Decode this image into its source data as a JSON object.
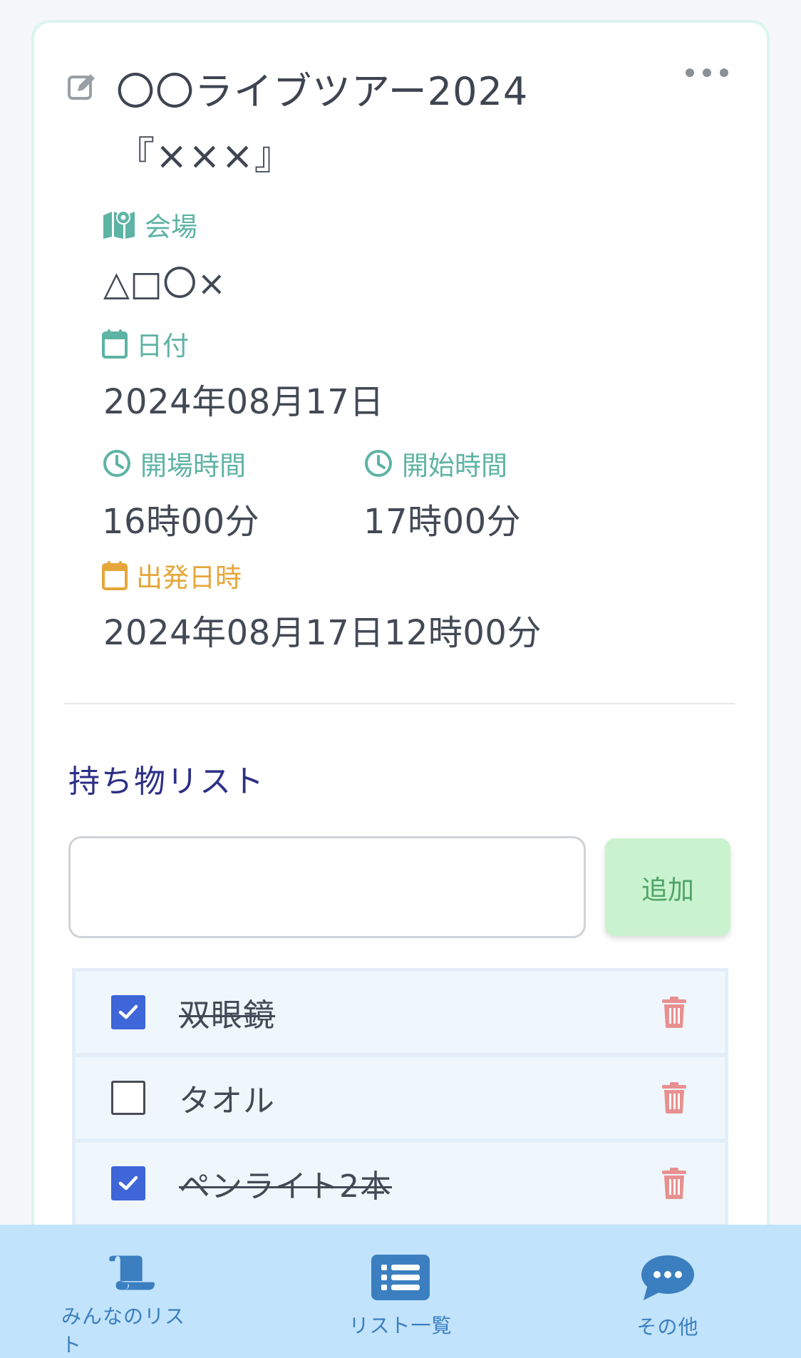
{
  "event": {
    "title": "〇〇ライブツアー2024『×××』",
    "venue_label": "会場",
    "venue_value": "△□〇×",
    "date_label": "日付",
    "date_value": "2024年08月17日",
    "open_label": "開場時間",
    "open_value": "16時00分",
    "start_label": "開始時間",
    "start_value": "17時00分",
    "departure_label": "出発日時",
    "departure_value": "2024年08月17日12時00分"
  },
  "checklist": {
    "title": "持ち物リスト",
    "input_value": "",
    "input_placeholder": "",
    "add_label": "追加",
    "items": [
      {
        "label": "双眼鏡",
        "checked": true
      },
      {
        "label": "タオル",
        "checked": false
      },
      {
        "label": "ペンライト2本",
        "checked": true
      }
    ]
  },
  "nav": {
    "items": [
      {
        "label": "みんなのリスト",
        "icon": "scroll-icon"
      },
      {
        "label": "リスト一覧",
        "icon": "list-icon"
      },
      {
        "label": "その他",
        "icon": "chat-icon"
      }
    ]
  },
  "colors": {
    "accent_teal": "#5db3a4",
    "accent_orange": "#e6a63a",
    "section_title": "#2d2f86",
    "checkbox_checked": "#3e66d8",
    "trash": "#e88f8f",
    "add_button_bg": "#c9f3cf",
    "nav_bg": "#c1e3fb",
    "nav_icon": "#3b7fc0"
  }
}
